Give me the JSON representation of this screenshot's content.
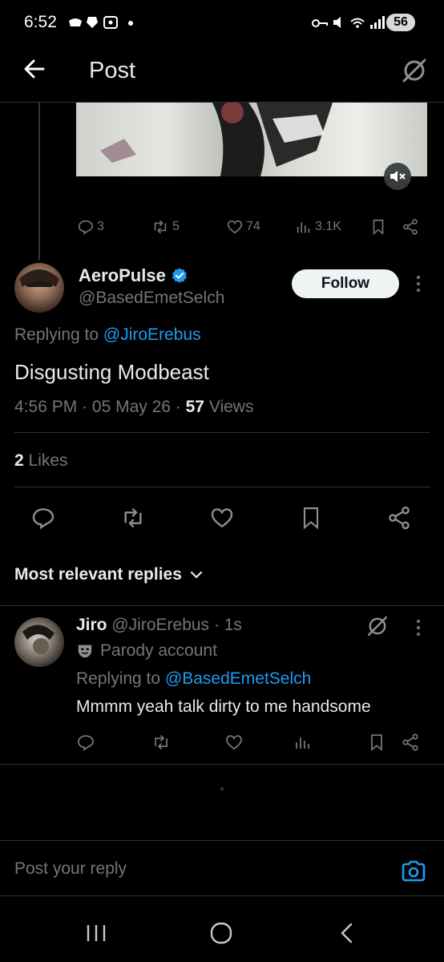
{
  "status_bar": {
    "time": "6:52",
    "battery": "56"
  },
  "header": {
    "title": "Post"
  },
  "parent_post": {
    "stats": {
      "replies": "3",
      "reposts": "5",
      "likes": "74",
      "views": "3.1K"
    }
  },
  "post": {
    "author_name": "AeroPulse",
    "author_handle": "@BasedEmetSelch",
    "follow_label": "Follow",
    "replying_prefix": "Replying to",
    "replying_to": "@JiroErebus",
    "text": "Disgusting Modbeast",
    "time": "4:56 PM",
    "date": "05 May 26",
    "views_count": "57",
    "views_label": "Views",
    "likes_count": "2",
    "likes_label": "Likes"
  },
  "replies_section": {
    "label": "Most relevant replies"
  },
  "reply": {
    "author_name": "Jiro",
    "author_handle": "@JiroErebus",
    "age": "1s",
    "badge": "Parody account",
    "replying_prefix": "Replying to",
    "replying_to": "@BasedEmetSelch",
    "text": "Mmmm yeah talk dirty to me handsome"
  },
  "composer": {
    "placeholder": "Post your reply"
  },
  "colors": {
    "accent": "#1d9bf0",
    "background": "#000000",
    "muted": "#71767b",
    "divider": "#2f3336"
  }
}
